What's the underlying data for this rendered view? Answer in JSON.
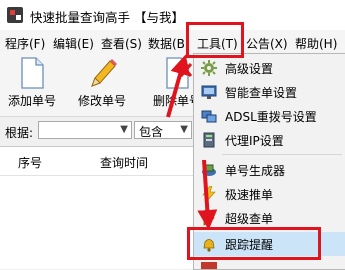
{
  "window": {
    "title": "快速批量查询高手 【与我】"
  },
  "menubar": {
    "items": [
      {
        "label": "程序(F)"
      },
      {
        "label": "编辑(E)"
      },
      {
        "label": "查看(S)"
      },
      {
        "label": "数据(B)"
      },
      {
        "label": "工具(T)"
      },
      {
        "label": "公告(X)"
      },
      {
        "label": "帮助(H)"
      }
    ]
  },
  "toolbar": {
    "add_label": "添加单号",
    "edit_label": "修改单号",
    "delete_label": "删除单号"
  },
  "filter": {
    "label": "根据:",
    "field_value": "",
    "mode_value": "包含"
  },
  "table": {
    "columns": [
      "序号",
      "查询时间"
    ]
  },
  "tools_menu": {
    "items": [
      {
        "label": "高级设置",
        "icon": "gear-icon"
      },
      {
        "label": "智能查单设置",
        "icon": "monitor-icon"
      },
      {
        "label": "ADSL重拨号设置",
        "icon": "network-icon"
      },
      {
        "label": "代理IP设置",
        "icon": "server-icon"
      },
      {
        "label": "单号生成器",
        "icon": "generator-icon"
      },
      {
        "label": "极速推单",
        "icon": "lightning-icon"
      },
      {
        "label": "超级查单",
        "icon": "super-query-icon"
      },
      {
        "label": "跟踪提醒",
        "icon": "bell-icon"
      }
    ],
    "highlighted": "跟踪提醒"
  },
  "annotation_color": "#e0141e"
}
